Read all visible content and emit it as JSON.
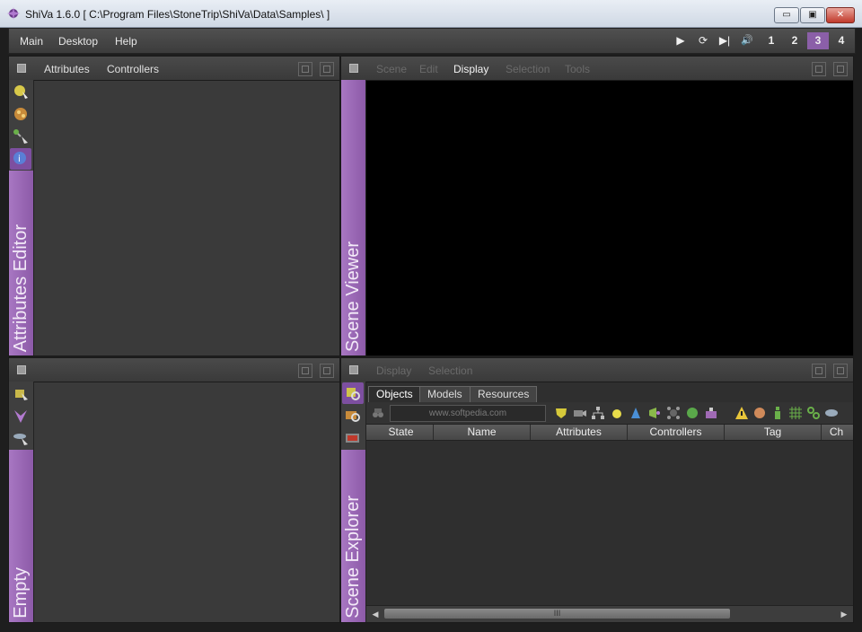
{
  "window": {
    "title": "ShiVa 1.6.0 [ C:\\Program Files\\StoneTrip\\ShiVa\\Data\\Samples\\ ]",
    "buttons": {
      "minimize": "▭",
      "maximize": "▣",
      "close": "✕"
    }
  },
  "menubar": {
    "items": [
      "Main",
      "Desktop",
      "Help"
    ],
    "playback": {
      "play": "▶",
      "refresh": "⟳",
      "step": "▶|",
      "sound": "🔊"
    },
    "desktops": [
      "1",
      "2",
      "3",
      "4"
    ],
    "active_desktop": "3"
  },
  "attributes_panel": {
    "tabs": [
      "Attributes",
      "Controllers"
    ],
    "label": "Attributes Editor",
    "tools": [
      "attribute-tool-1-icon",
      "attribute-tool-2-icon",
      "attribute-tool-3-icon",
      "attribute-tool-info-icon"
    ]
  },
  "scene_viewer": {
    "tabs": [
      "Scene",
      "Edit",
      "Display",
      "Selection",
      "Tools"
    ],
    "active_tab": "Display",
    "label": "Scene Viewer"
  },
  "empty_panel": {
    "label": "Empty"
  },
  "scene_explorer": {
    "tabs": [
      "Display",
      "Selection"
    ],
    "label": "Scene Explorer",
    "subtabs": [
      "Objects",
      "Models",
      "Resources"
    ],
    "active_subtab": "Objects",
    "search_placeholder": "www.softpedia.com",
    "columns": [
      "State",
      "Name",
      "Attributes",
      "Controllers",
      "Tag",
      "Ch"
    ],
    "scroll_thumb": "III"
  },
  "colors": {
    "accent_purple": "#9b6bb5",
    "panel_bg": "#3c3c3c",
    "viewer_bg": "#000000"
  }
}
